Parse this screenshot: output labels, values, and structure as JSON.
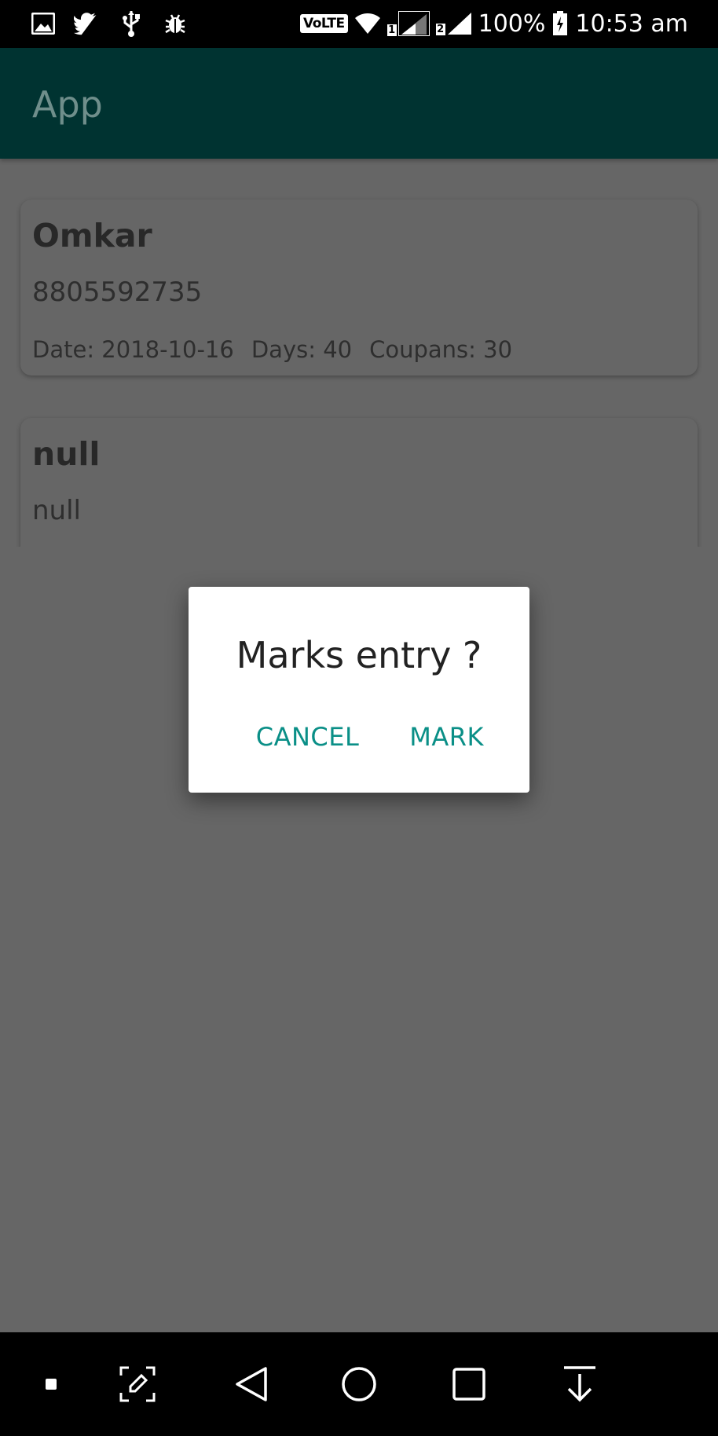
{
  "status_bar": {
    "icons_left": [
      "gallery-icon",
      "twitter-icon",
      "usb-icon",
      "bug-icon"
    ],
    "volte": "VoLTE",
    "sim1": "1",
    "sim2": "2",
    "battery": "100%",
    "time": "10:53 am"
  },
  "app_bar": {
    "title": "App"
  },
  "entries": [
    {
      "name": "Omkar",
      "phone": "8805592735",
      "date": "Date: 2018-10-16",
      "days": "Days: 40",
      "coupans": "Coupans: 30"
    },
    {
      "name": "null",
      "phone": "null"
    }
  ],
  "dialog": {
    "title": "Marks entry ?",
    "cancel_label": "CANCEL",
    "mark_label": "MARK",
    "accent_color": "#0a8f87"
  },
  "nav_bar": {
    "icons": [
      "dot-icon",
      "screenshot-edit-icon",
      "back-icon",
      "home-icon",
      "recents-icon",
      "notification-pull-icon"
    ]
  },
  "colors": {
    "scrim": "#666666",
    "app_bar_dimmed": "#003331"
  }
}
